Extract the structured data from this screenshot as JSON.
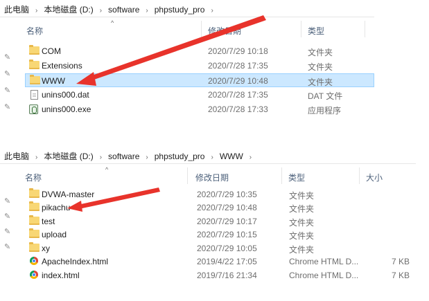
{
  "window1": {
    "breadcrumb": [
      "此电脑",
      "本地磁盘 (D:)",
      "software",
      "phpstudy_pro"
    ],
    "columns": {
      "name": "名称",
      "date": "修改日期",
      "type": "类型"
    },
    "rows": [
      {
        "name": "COM",
        "date": "2020/7/29 10:18",
        "type": "文件夹",
        "icon": "folder-icon"
      },
      {
        "name": "Extensions",
        "date": "2020/7/28 17:35",
        "type": "文件夹",
        "icon": "folder-icon"
      },
      {
        "name": "WWW",
        "date": "2020/7/29 10:48",
        "type": "文件夹",
        "icon": "folder-icon",
        "selected": true
      },
      {
        "name": "unins000.dat",
        "date": "2020/7/28 17:35",
        "type": "DAT 文件",
        "icon": "file-icon"
      },
      {
        "name": "unins000.exe",
        "date": "2020/7/28 17:33",
        "type": "应用程序",
        "icon": "exe-icon"
      }
    ]
  },
  "window2": {
    "breadcrumb": [
      "此电脑",
      "本地磁盘 (D:)",
      "software",
      "phpstudy_pro",
      "WWW"
    ],
    "columns": {
      "name": "名称",
      "date": "修改日期",
      "type": "类型",
      "size": "大小"
    },
    "rows": [
      {
        "name": "DVWA-master",
        "date": "2020/7/29 10:35",
        "type": "文件夹",
        "size": "",
        "icon": "folder-icon"
      },
      {
        "name": "pikachu",
        "date": "2020/7/29 10:48",
        "type": "文件夹",
        "size": "",
        "icon": "folder-icon"
      },
      {
        "name": "test",
        "date": "2020/7/29 10:17",
        "type": "文件夹",
        "size": "",
        "icon": "folder-icon"
      },
      {
        "name": "upload",
        "date": "2020/7/29 10:15",
        "type": "文件夹",
        "size": "",
        "icon": "folder-icon"
      },
      {
        "name": "xy",
        "date": "2020/7/29 10:05",
        "type": "文件夹",
        "size": "",
        "icon": "folder-icon"
      },
      {
        "name": "ApacheIndex.html",
        "date": "2019/4/22 17:05",
        "type": "Chrome HTML D...",
        "size": "7 KB",
        "icon": "chrome-icon"
      },
      {
        "name": "index.html",
        "date": "2019/7/16 21:34",
        "type": "Chrome HTML D...",
        "size": "7 KB",
        "icon": "chrome-icon"
      }
    ]
  },
  "annotation_color": "#e8332b"
}
